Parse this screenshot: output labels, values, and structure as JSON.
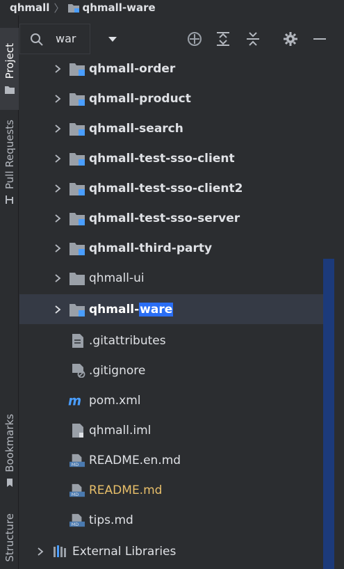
{
  "breadcrumb": {
    "root": "qhmall",
    "current": "qhmall-ware"
  },
  "toolstrip": {
    "project": "Project",
    "pull_requests": "Pull Requests",
    "bookmarks": "Bookmarks",
    "structure": "Structure"
  },
  "search": {
    "value": "war"
  },
  "tree": {
    "modules": [
      {
        "label": "qhmall-order"
      },
      {
        "label": "qhmall-product"
      },
      {
        "label": "qhmall-search"
      },
      {
        "label": "qhmall-test-sso-client"
      },
      {
        "label": "qhmall-test-sso-client2"
      },
      {
        "label": "qhmall-test-sso-server"
      },
      {
        "label": "qhmall-third-party"
      },
      {
        "label": "qhmall-ui"
      }
    ],
    "selected": {
      "prefix": "qhmall-",
      "match": "ware"
    },
    "files": [
      {
        "label": ".gitattributes"
      },
      {
        "label": ".gitignore"
      },
      {
        "label": "pom.xml"
      },
      {
        "label": "qhmall.iml"
      },
      {
        "label": "README.en.md"
      },
      {
        "label": "README.md"
      },
      {
        "label": "tips.md"
      }
    ],
    "external": "External Libraries"
  },
  "colors": {
    "accent": "#2a6ef5",
    "module_badge": "#4a9eff",
    "readme": "#e8bf6a",
    "scrollbar": "#1c3a7a"
  }
}
